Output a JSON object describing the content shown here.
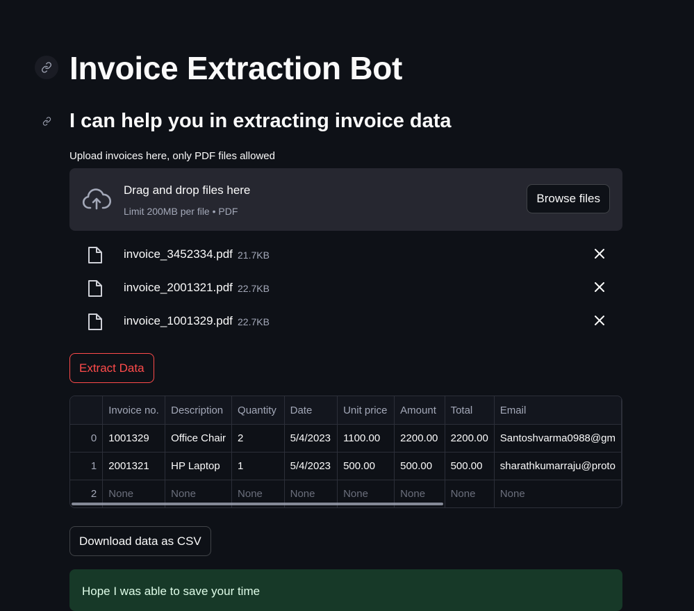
{
  "header": {
    "title": "Invoice Extraction Bot",
    "subtitle": "I can help you in extracting invoice data"
  },
  "uploader": {
    "label": "Upload invoices here, only PDF files allowed",
    "drop_text": "Drag and drop files here",
    "limit_text": "Limit 200MB per file • PDF",
    "browse_label": "Browse files"
  },
  "files": [
    {
      "name": "invoice_3452334.pdf",
      "size": "21.7KB"
    },
    {
      "name": "invoice_2001321.pdf",
      "size": "22.7KB"
    },
    {
      "name": "invoice_1001329.pdf",
      "size": "22.7KB"
    }
  ],
  "actions": {
    "extract_label": "Extract Data",
    "download_label": "Download data as CSV"
  },
  "table": {
    "columns": [
      "",
      "Invoice no.",
      "Description",
      "Quantity",
      "Date",
      "Unit price",
      "Amount",
      "Total",
      "Email"
    ],
    "rows": [
      [
        "0",
        "1001329",
        "Office Chair",
        "2",
        "5/4/2023",
        "1100.00",
        "2200.00",
        "2200.00",
        "Santoshvarma0988@gm"
      ],
      [
        "1",
        "2001321",
        "HP Laptop",
        "1",
        "5/4/2023",
        "500.00",
        "500.00",
        "500.00",
        "sharathkumarraju@proto"
      ],
      [
        "2",
        "None",
        "None",
        "None",
        "None",
        "None",
        "None",
        "None",
        "None"
      ]
    ]
  },
  "status": {
    "success_message": "Hope I was able to save your time"
  },
  "colors": {
    "background": "#0e1117",
    "accent": "#ff4b4b",
    "surface": "#262730",
    "success_bg": "#173928"
  },
  "icons": {
    "anchor": "link-icon",
    "upload": "cloud-upload-icon",
    "file": "file-icon",
    "remove": "close-icon"
  }
}
